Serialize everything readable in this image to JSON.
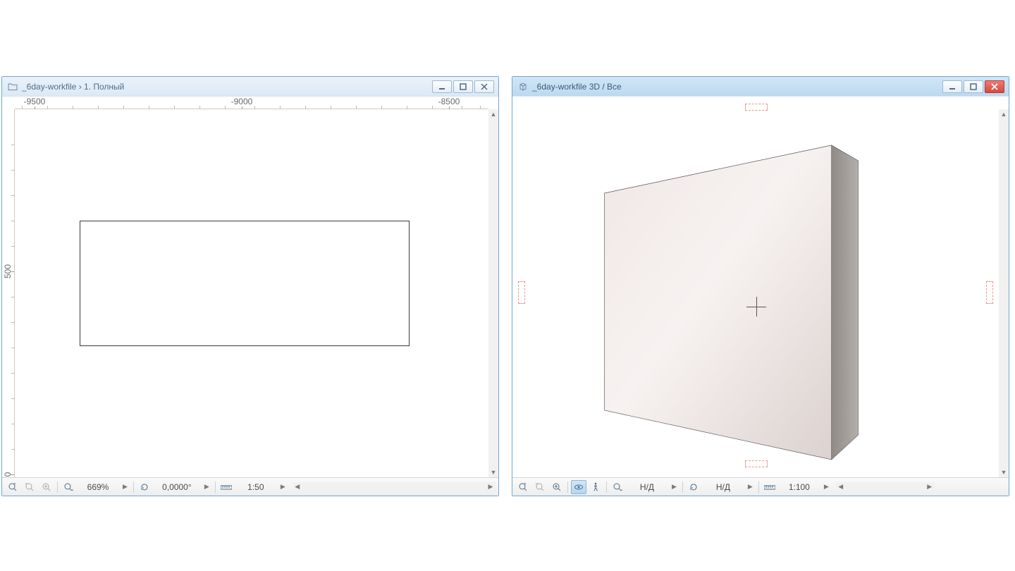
{
  "windows": {
    "left": {
      "title": "_6day-workfile › 1. Полный",
      "ruler_h": {
        "labels": [
          "-9500",
          "-9000",
          "-8500"
        ]
      },
      "ruler_v": {
        "labels": [
          "500",
          "0"
        ]
      },
      "status": {
        "zoom": "669%",
        "angle": "0,0000°",
        "scale": "1:50"
      }
    },
    "right": {
      "title": "_6day-workfile 3D / Все",
      "status": {
        "value1": "Н/Д",
        "value2": "Н/Д",
        "scale": "1:100"
      }
    }
  }
}
